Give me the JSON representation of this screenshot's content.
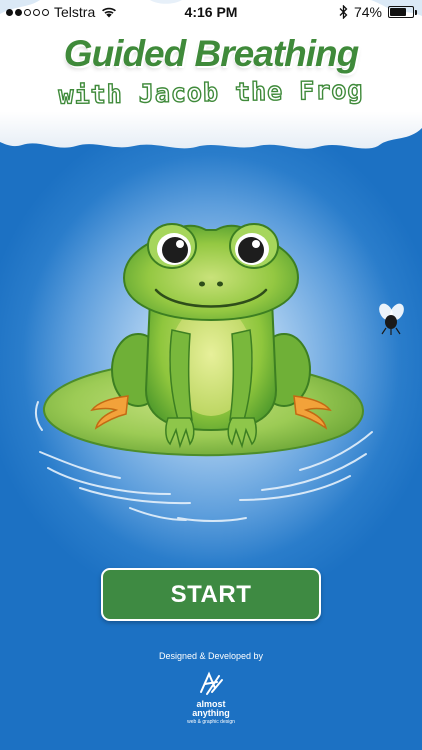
{
  "status_bar": {
    "carrier": "Telstra",
    "time": "4:16 PM",
    "battery_percent": "74%",
    "battery_level": 0.74,
    "signal_bars_filled": 2,
    "signal_bars_total": 5
  },
  "header": {
    "title": "Guided Breathing",
    "subtitle": "with Jacob the Frog"
  },
  "main": {
    "start_label": "START"
  },
  "footer": {
    "credit": "Designed & Developed by",
    "logo_name_line1": "almost",
    "logo_name_line2": "anything",
    "logo_tagline": "web & graphic design"
  },
  "colors": {
    "sky_blue": "#1f74c4",
    "title_green": "#3f8a3a",
    "button_green": "#3e8a42",
    "frog_green": "#8cc43c",
    "lily_pad_green": "#86c24a"
  }
}
